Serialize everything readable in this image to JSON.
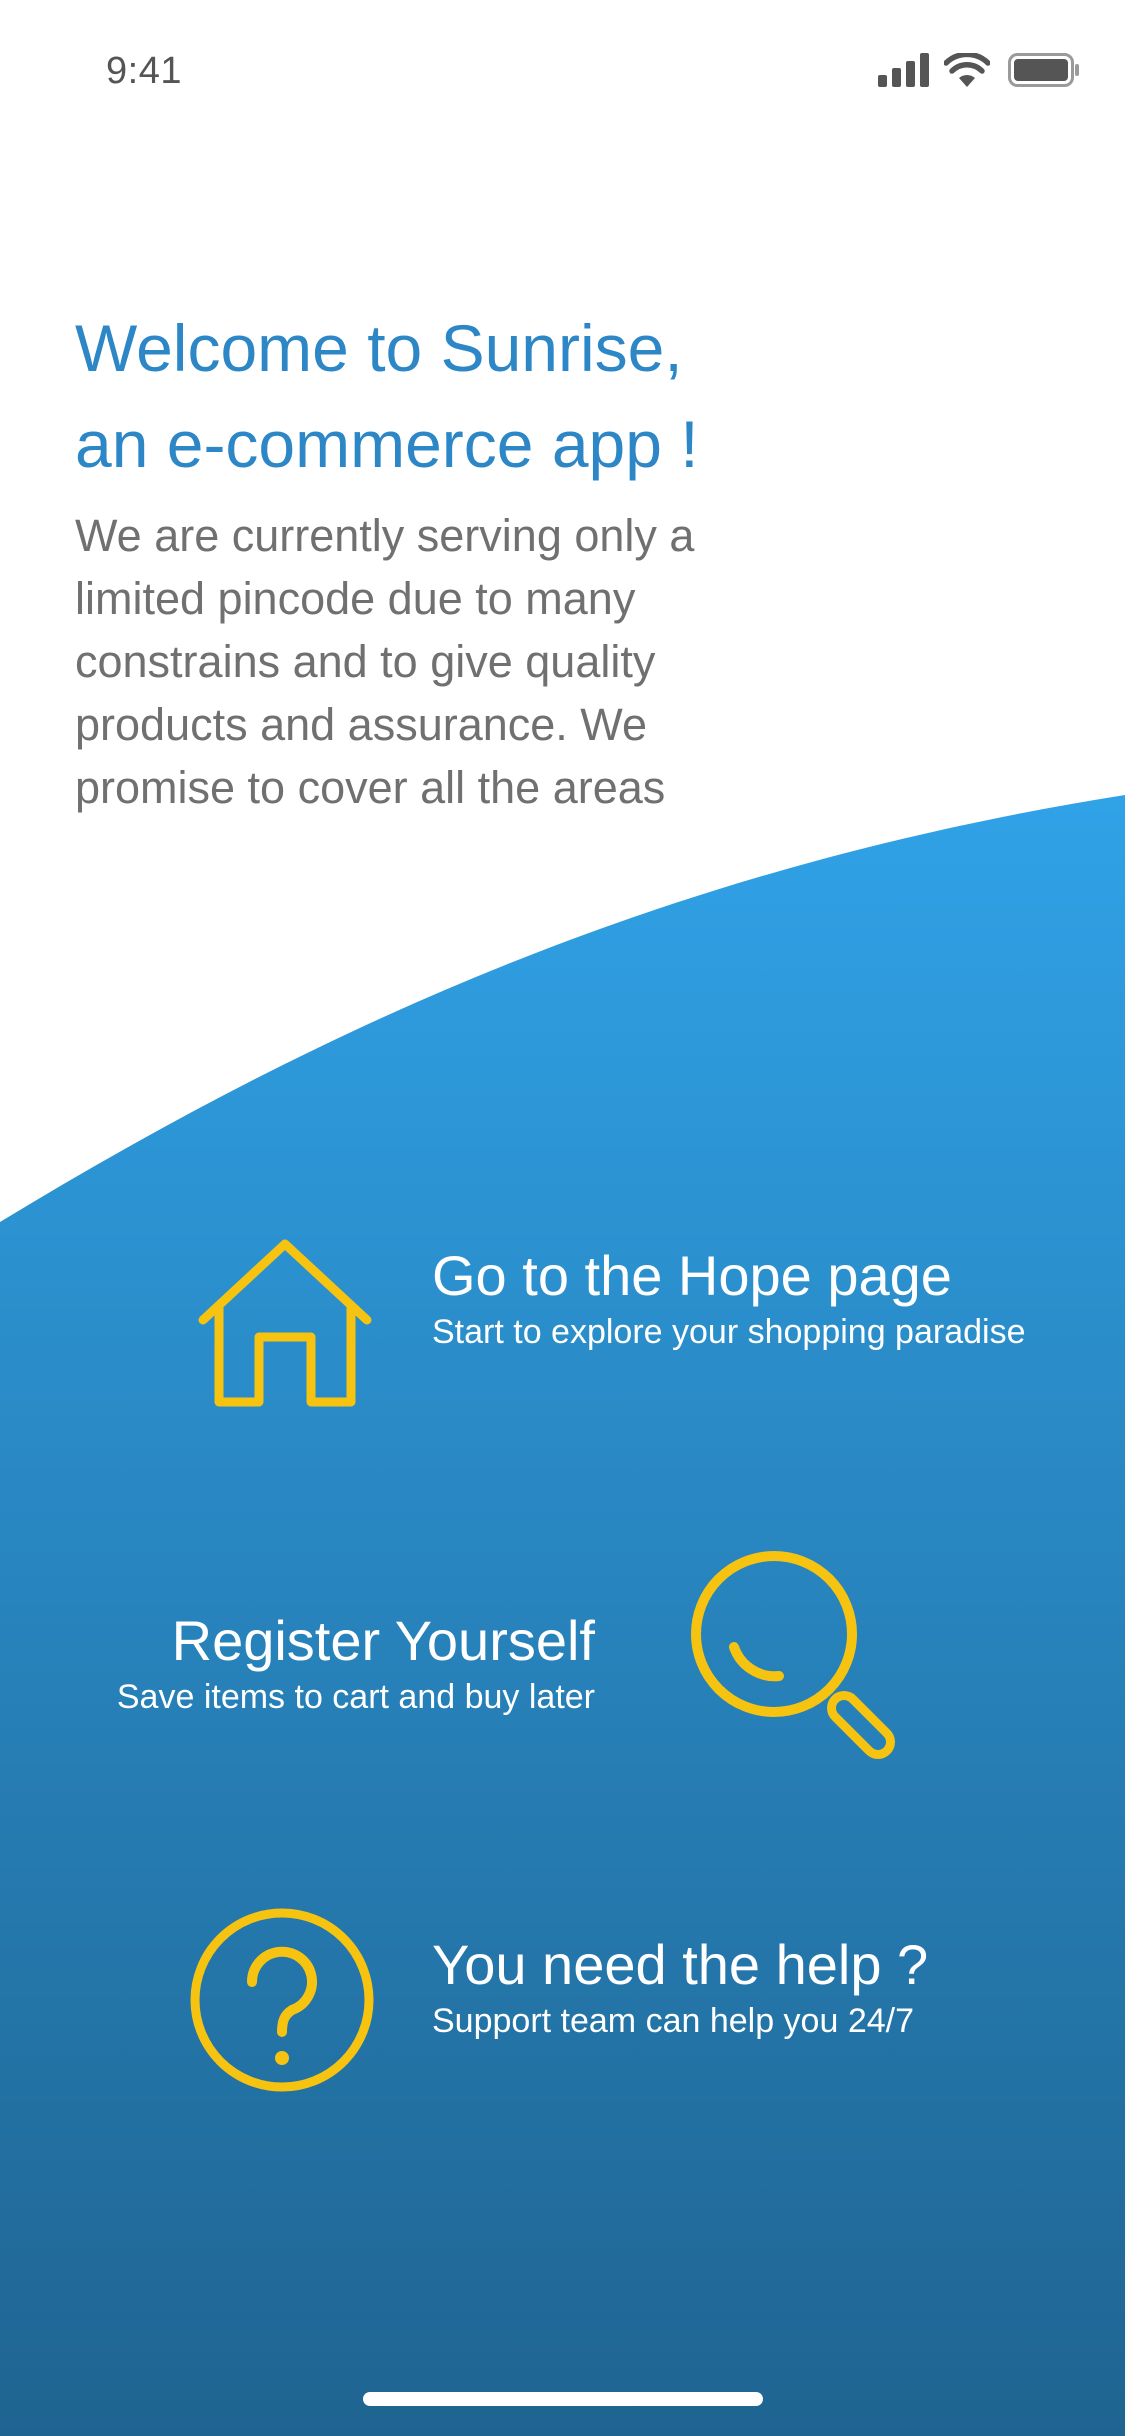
{
  "status_bar": {
    "time": "9:41",
    "icons": [
      "cellular-signal-icon",
      "wifi-icon",
      "battery-icon"
    ]
  },
  "intro": {
    "title": "Welcome to Sunrise,\nan e-commerce app !",
    "text": "We are currently serving only a limited pincode due to many constrains and to give quality products and assurance. We promise to cover all the areas"
  },
  "features": [
    {
      "title": "Go to the Hope page",
      "subtitle": "Start to explore your shopping paradise",
      "icon": "home-icon"
    },
    {
      "title": "Register Yourself",
      "subtitle": "Save items to cart and buy later",
      "icon": "search-icon"
    },
    {
      "title": "You need the help ?",
      "subtitle": "Support team can help you 24/7",
      "icon": "help-icon"
    }
  ],
  "colors": {
    "title_blue": "#2d87c6",
    "body_gray": "#707070",
    "gradient_top": "#30a2e7",
    "gradient_bottom": "#1f6491",
    "icon_yellow": "#f6c410"
  }
}
